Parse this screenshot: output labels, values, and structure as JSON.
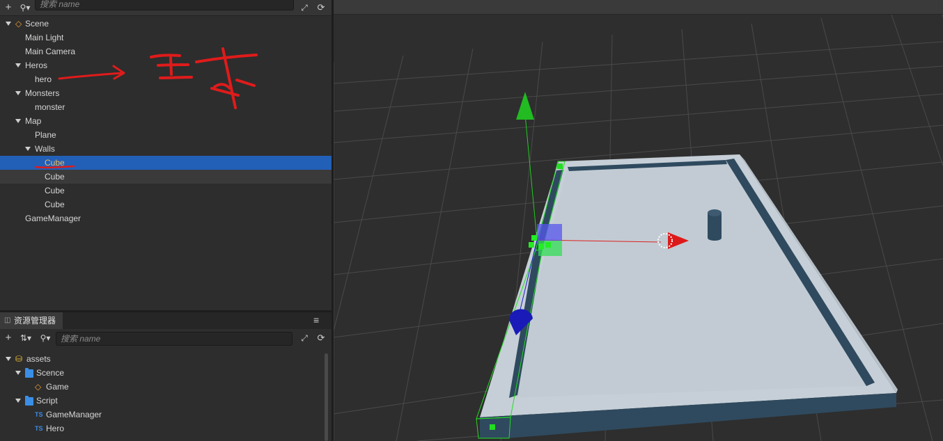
{
  "hierarchy": {
    "search_placeholder": "搜索 name",
    "nodes": [
      {
        "label": "Scene",
        "depth": 0,
        "expanded": true,
        "icon": "scene-icon"
      },
      {
        "label": "Main Light",
        "depth": 1
      },
      {
        "label": "Main Camera",
        "depth": 1
      },
      {
        "label": "Heros",
        "depth": 1,
        "expanded": true
      },
      {
        "label": "hero",
        "depth": 2
      },
      {
        "label": "Monsters",
        "depth": 1,
        "expanded": true
      },
      {
        "label": "monster",
        "depth": 2
      },
      {
        "label": "Map",
        "depth": 1,
        "expanded": true
      },
      {
        "label": "Plane",
        "depth": 2
      },
      {
        "label": "Walls",
        "depth": 2,
        "expanded": true
      },
      {
        "label": "Cube",
        "depth": 3,
        "selected": true
      },
      {
        "label": "Cube",
        "depth": 3,
        "hover": true
      },
      {
        "label": "Cube",
        "depth": 3
      },
      {
        "label": "Cube",
        "depth": 3
      },
      {
        "label": "GameManager",
        "depth": 1
      }
    ]
  },
  "annotation": {
    "text": "主球",
    "color": "#e01b1b"
  },
  "assets": {
    "tab_label": "资源管理器",
    "search_placeholder": "搜索 name",
    "nodes": [
      {
        "label": "assets",
        "depth": 0,
        "expanded": true,
        "icon": "database-icon"
      },
      {
        "label": "Scence",
        "depth": 1,
        "expanded": true,
        "icon": "folder-icon"
      },
      {
        "label": "Game",
        "depth": 2,
        "icon": "scene-icon"
      },
      {
        "label": "Script",
        "depth": 1,
        "expanded": true,
        "icon": "folder-icon"
      },
      {
        "label": "GameManager",
        "depth": 2,
        "icon": "ts-icon"
      },
      {
        "label": "Hero",
        "depth": 2,
        "icon": "ts-icon"
      }
    ],
    "ts_badge": "TS"
  },
  "colors": {
    "selection": "#2260b8",
    "selected_text": "#f0b85a",
    "gizmo_x": "#e02020",
    "gizmo_y": "#22cc22",
    "gizmo_z": "#2020d0",
    "board": "#c5ced6",
    "wall_dark": "#2f4a5f"
  }
}
